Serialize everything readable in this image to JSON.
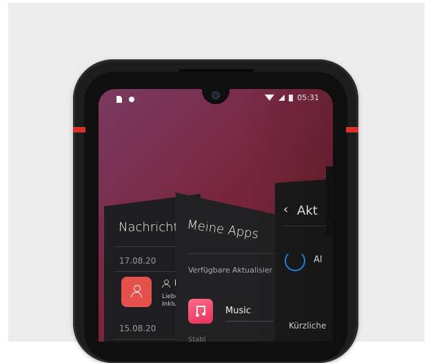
{
  "status_bar": {
    "time": "05:31",
    "icons": [
      "sim-card-icon",
      "notification-dot-icon",
      "wifi-icon",
      "signal-icon",
      "battery-icon"
    ]
  },
  "panels": {
    "messages": {
      "title": "Nachricht",
      "dates": [
        "17.08.20",
        "15.08.20"
      ],
      "sender": "E",
      "preview_lines": [
        "Lieber",
        "Inklusi"
      ]
    },
    "apps": {
      "title": "Meine Apps",
      "subtitle": "Verfügbare Aktualisier",
      "app_name": "Music",
      "faded_text": "Stabl"
    },
    "updates": {
      "back_glyph": "‹",
      "title": "Akt",
      "row_label": "Al",
      "recent": "Kürzliche"
    }
  },
  "colors": {
    "accent_red": "#d8312b",
    "badge_red": "#e5514b",
    "spinner_blue": "#1e8ef0"
  }
}
